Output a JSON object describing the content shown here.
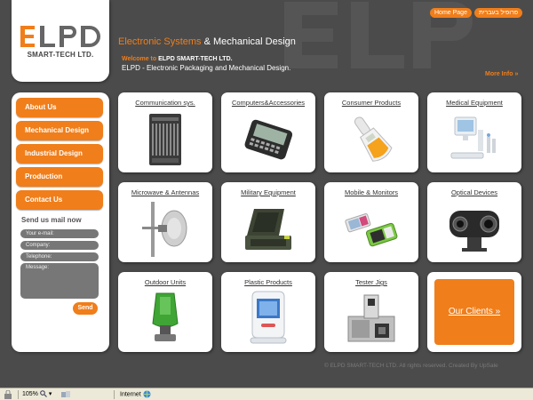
{
  "brand": {
    "logo_text": "ELPD",
    "sub": "SMART-TECH LTD."
  },
  "top_buttons": [
    "Home Page",
    "פרופיל בעברית"
  ],
  "header": {
    "title_orange": "Electronic Systems",
    "title_white": " & Mechanical Design",
    "welcome_orange": "Welcome to ",
    "welcome_white": "ELPD SMART-TECH LTD.",
    "subline": "ELPD - Electronic Packaging and Mechanical Design.",
    "more_info": "More Info »"
  },
  "nav": [
    "About Us",
    "Mechanical Design",
    "Industrial Design",
    "Production",
    "Contact Us"
  ],
  "mail": {
    "title": "Send us mail now",
    "fields": [
      "Your e-mail:",
      "Company:",
      "Telephone:"
    ],
    "message": "Message:",
    "send": "Send"
  },
  "tiles": [
    {
      "label": "Communication sys.",
      "icon": "rack-icon"
    },
    {
      "label": "Computers&Accessories",
      "icon": "handheld-icon"
    },
    {
      "label": "Consumer Products",
      "icon": "thermometer-icon"
    },
    {
      "label": "Medical Equipment",
      "icon": "medical-workstation-icon"
    },
    {
      "label": "Microwave & Antennas",
      "icon": "antenna-icon"
    },
    {
      "label": "Military Equipment",
      "icon": "rugged-case-icon"
    },
    {
      "label": "Mobile & Monitors",
      "icon": "mobile-phones-icon"
    },
    {
      "label": "Optical Devices",
      "icon": "optical-device-icon"
    },
    {
      "label": "Outdoor Units",
      "icon": "outdoor-unit-icon"
    },
    {
      "label": "Plastic Products",
      "icon": "plastic-device-icon"
    },
    {
      "label": "Tester Jigs",
      "icon": "tester-jig-icon"
    }
  ],
  "clients": "Our Clients »",
  "copyright": "© ELPD SMART-TECH LTD. All rights reserved. Created By UpSale",
  "statusbar": {
    "zoom": "105%",
    "zone": "Internet"
  },
  "colors": {
    "accent": "#f07e1a",
    "background": "#4b4b4b",
    "panel": "#ffffff"
  }
}
